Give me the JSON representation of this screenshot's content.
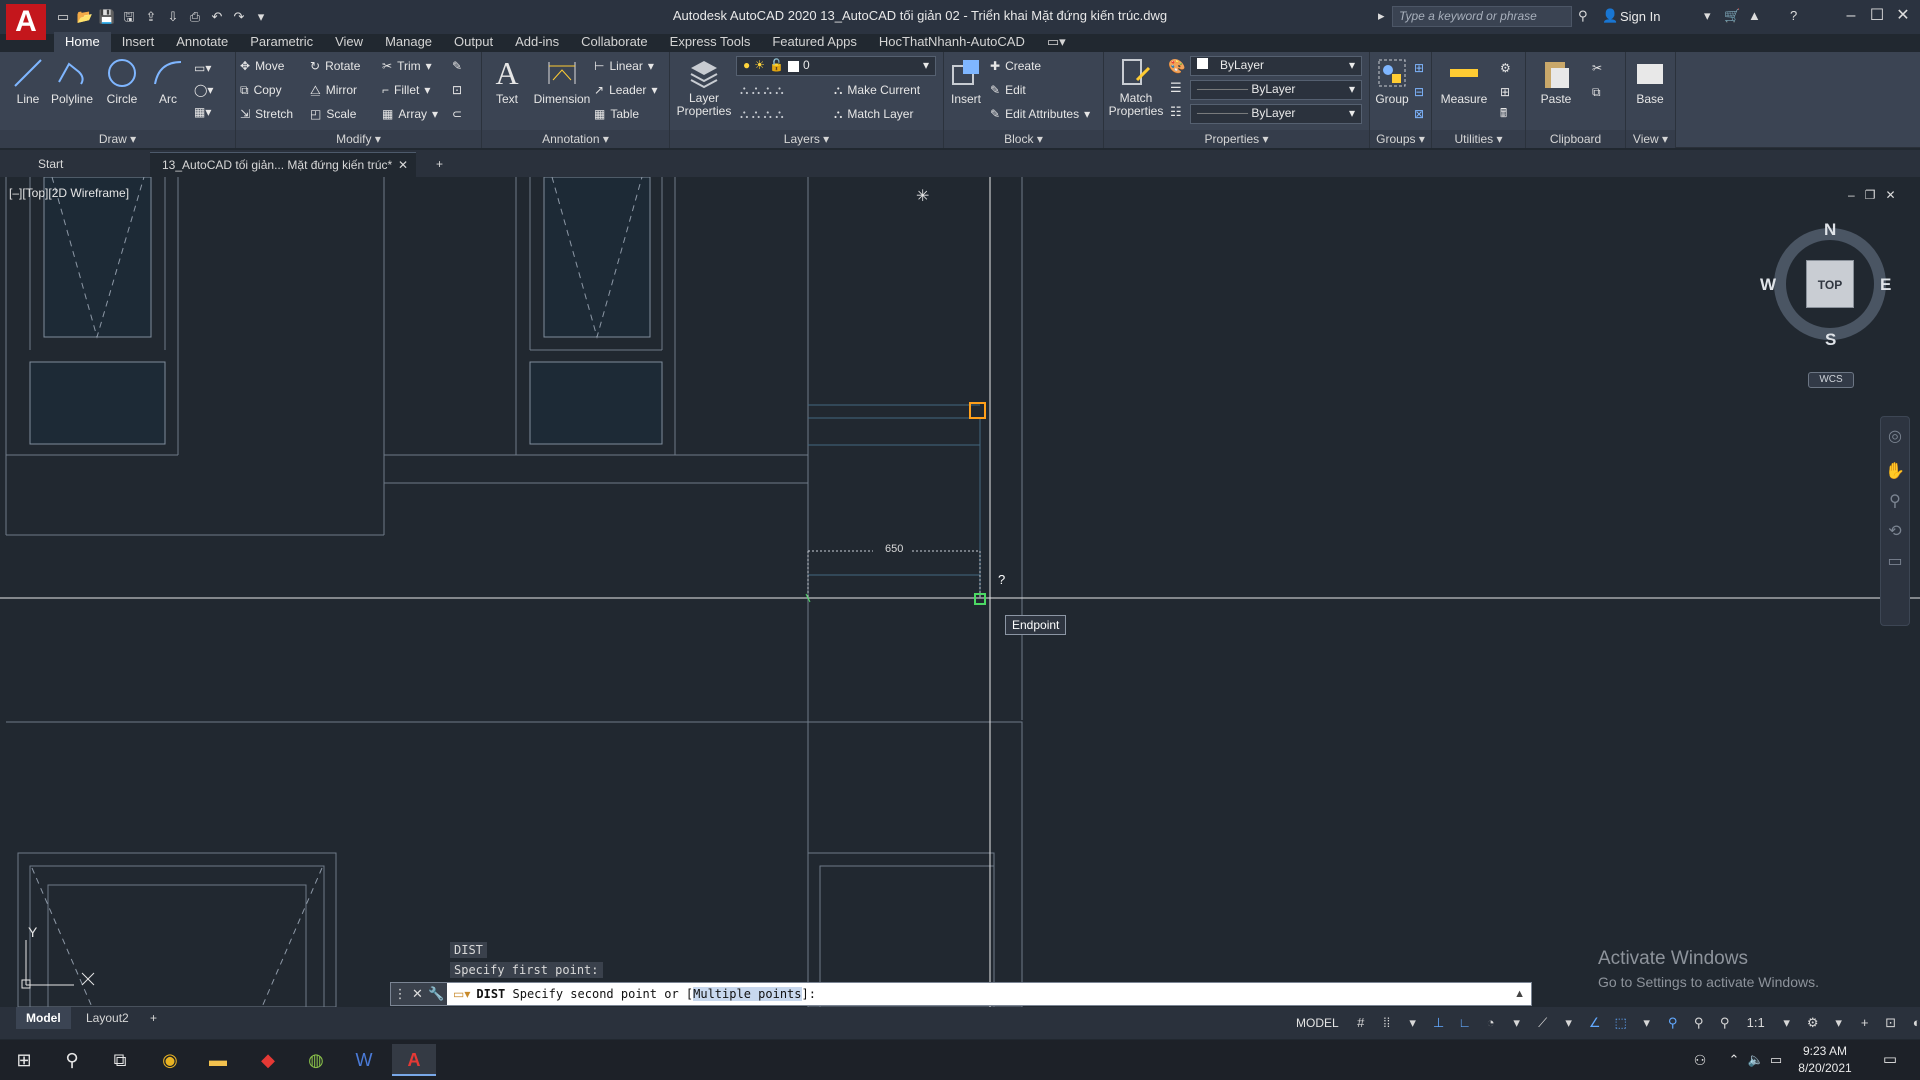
{
  "app": {
    "logo_letter": "A",
    "window_title": "Autodesk AutoCAD 2020    13_AutoCAD tối giản 02 - Triển khai Mặt đứng kiến trúc.dwg",
    "search_placeholder": "Type a keyword or phrase",
    "sign_in": "Sign In"
  },
  "menu_tabs": [
    "Home",
    "Insert",
    "Annotate",
    "Parametric",
    "View",
    "Manage",
    "Output",
    "Add-ins",
    "Collaborate",
    "Express Tools",
    "Featured Apps",
    "HocThatNhanh-AutoCAD"
  ],
  "ribbon": {
    "draw": {
      "label": "Draw",
      "line": "Line",
      "polyline": "Polyline",
      "circle": "Circle",
      "arc": "Arc"
    },
    "modify": {
      "label": "Modify",
      "move": "Move",
      "rotate": "Rotate",
      "trim": "Trim",
      "copy": "Copy",
      "mirror": "Mirror",
      "fillet": "Fillet",
      "stretch": "Stretch",
      "scale": "Scale",
      "array": "Array"
    },
    "annotation": {
      "label": "Annotation",
      "text": "Text",
      "dimension": "Dimension",
      "linear": "Linear",
      "leader": "Leader",
      "table": "Table"
    },
    "layers": {
      "label": "Layers",
      "layer_properties": "Layer Properties",
      "current_layer": "0",
      "make_current": "Make Current",
      "match_layer": "Match Layer"
    },
    "block": {
      "label": "Block",
      "insert": "Insert",
      "create": "Create",
      "edit": "Edit",
      "edit_attributes": "Edit Attributes"
    },
    "properties": {
      "label": "Properties",
      "match_properties": "Match Properties",
      "color": "ByLayer",
      "lineweight": "ByLayer",
      "linetype": "ByLayer"
    },
    "groups": {
      "label": "Groups",
      "group": "Group"
    },
    "utilities": {
      "label": "Utilities",
      "measure": "Measure"
    },
    "clipboard": {
      "label": "Clipboard",
      "paste": "Paste"
    },
    "view": {
      "label": "View",
      "base": "Base"
    }
  },
  "doc_tabs": {
    "start": "Start",
    "current": "13_AutoCAD tối giản... Mặt đứng kiến trúc*"
  },
  "viewport": {
    "label": "[–][Top][2D Wireframe]",
    "compass": {
      "n": "N",
      "s": "S",
      "e": "E",
      "w": "W",
      "top": "TOP"
    },
    "wcs": "WCS",
    "dim_text": "650",
    "osnap_tooltip": "Endpoint",
    "cursor_hint": "?",
    "ucs_x": "X",
    "ucs_y": "Y",
    "watermark_title": "Activate Windows",
    "watermark_sub": "Go to Settings to activate Windows."
  },
  "command": {
    "history_1": "DIST",
    "history_2": "Specify first point:",
    "prompt_cmd": "DIST",
    "prompt_text": " Specify second point or [",
    "prompt_option": "Multiple points",
    "prompt_end": "]:"
  },
  "layouts": {
    "model": "Model",
    "layout2": "Layout2",
    "add": "+"
  },
  "status": {
    "model": "MODEL",
    "scale": "1:1"
  },
  "clock": {
    "time": "9:23 AM",
    "date": "8/20/2021"
  }
}
